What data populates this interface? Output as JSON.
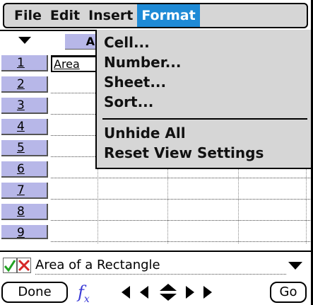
{
  "menubar": {
    "items": [
      {
        "label": "File"
      },
      {
        "label": "Edit"
      },
      {
        "label": "Insert"
      },
      {
        "label": "Format"
      }
    ],
    "active": "Format"
  },
  "grid": {
    "columns": [
      "A"
    ],
    "rows": [
      "1",
      "2",
      "3",
      "4",
      "5",
      "6",
      "7",
      "8",
      "9"
    ],
    "selected_cell": {
      "ref": "A1",
      "value": "Area"
    }
  },
  "format_menu": {
    "items": [
      {
        "label": "Cell..."
      },
      {
        "label": "Number..."
      },
      {
        "label": "Sheet..."
      },
      {
        "label": "Sort..."
      },
      {
        "label": "Unhide All"
      },
      {
        "label": "Reset View Settings"
      }
    ]
  },
  "entry": {
    "value": "Area of a Rectangle"
  },
  "bottombar": {
    "done_label": "Done",
    "fx_label": "f",
    "fx_sub": "x",
    "go_label": "Go"
  },
  "colors": {
    "menu_bg": "#d6d6d6",
    "active_menu": "#1e8ad6",
    "header_bg": "#b7b7e8",
    "check_green": "#22a322",
    "x_red": "#d62828",
    "fx_blue": "#3b3bd6"
  }
}
